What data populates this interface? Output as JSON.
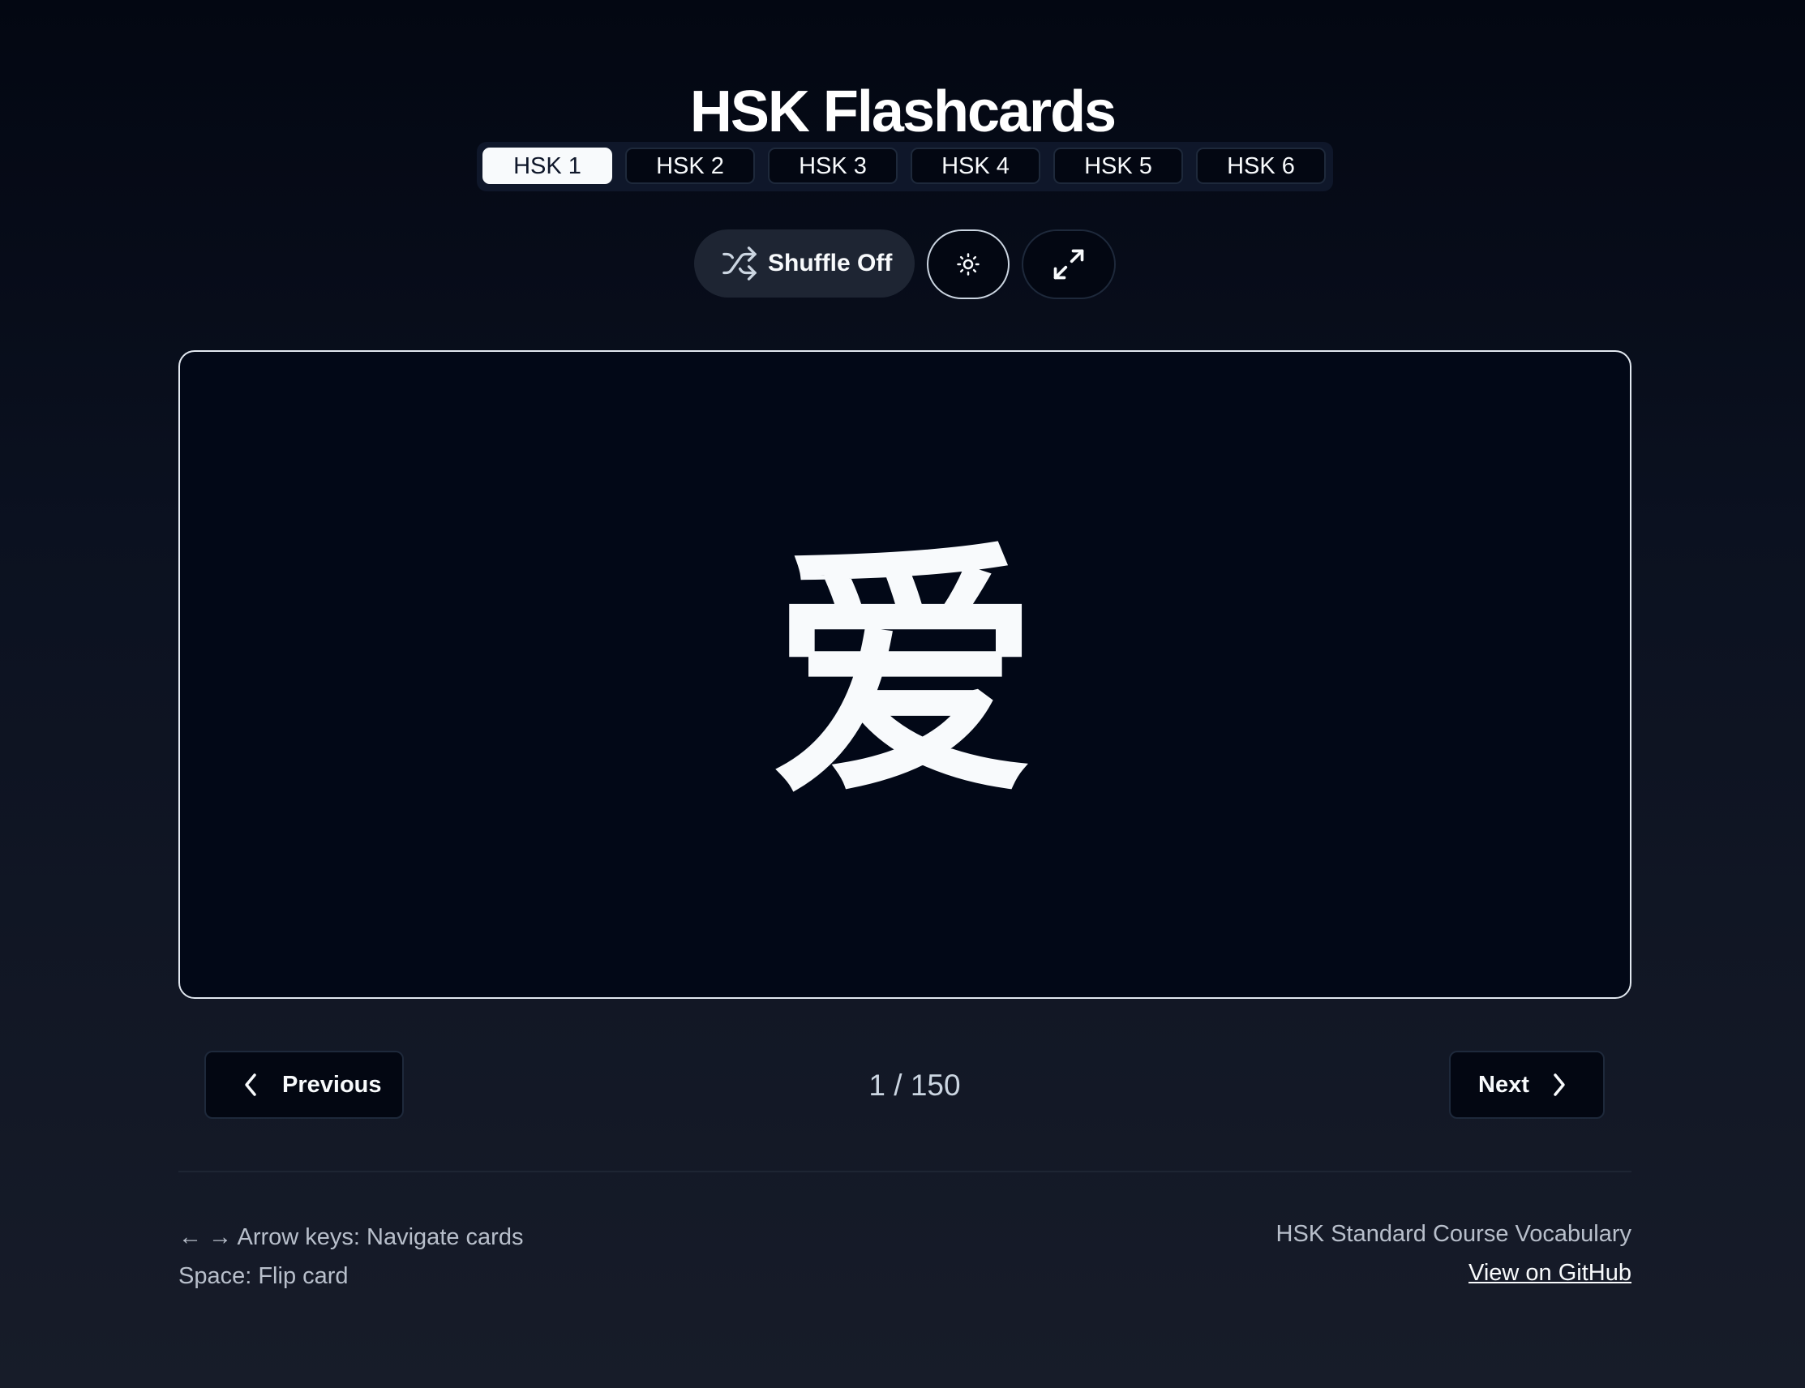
{
  "title": "HSK Flashcards",
  "levels": [
    {
      "label": "HSK 1",
      "active": true
    },
    {
      "label": "HSK 2",
      "active": false
    },
    {
      "label": "HSK 3",
      "active": false
    },
    {
      "label": "HSK 4",
      "active": false
    },
    {
      "label": "HSK 5",
      "active": false
    },
    {
      "label": "HSK 6",
      "active": false
    }
  ],
  "controls": {
    "shuffle_label": "Shuffle Off",
    "shuffle_icon": "shuffle-icon",
    "theme_icon": "sun-icon",
    "fullscreen_icon": "expand-icon"
  },
  "card": {
    "character": "爱"
  },
  "navigation": {
    "previous_label": "Previous",
    "next_label": "Next",
    "counter": "1 / 150"
  },
  "footer": {
    "shortcut_navigate": "← → Arrow keys: Navigate cards",
    "shortcut_flip": "Space: Flip card",
    "source": "HSK Standard Course Vocabulary",
    "github_link": "View on GitHub"
  },
  "colors": {
    "background": "#030712",
    "card_background": "#020817",
    "active_tab": "#f8fafc",
    "text": "#f8fafc",
    "muted_text": "#b8bfcb"
  }
}
